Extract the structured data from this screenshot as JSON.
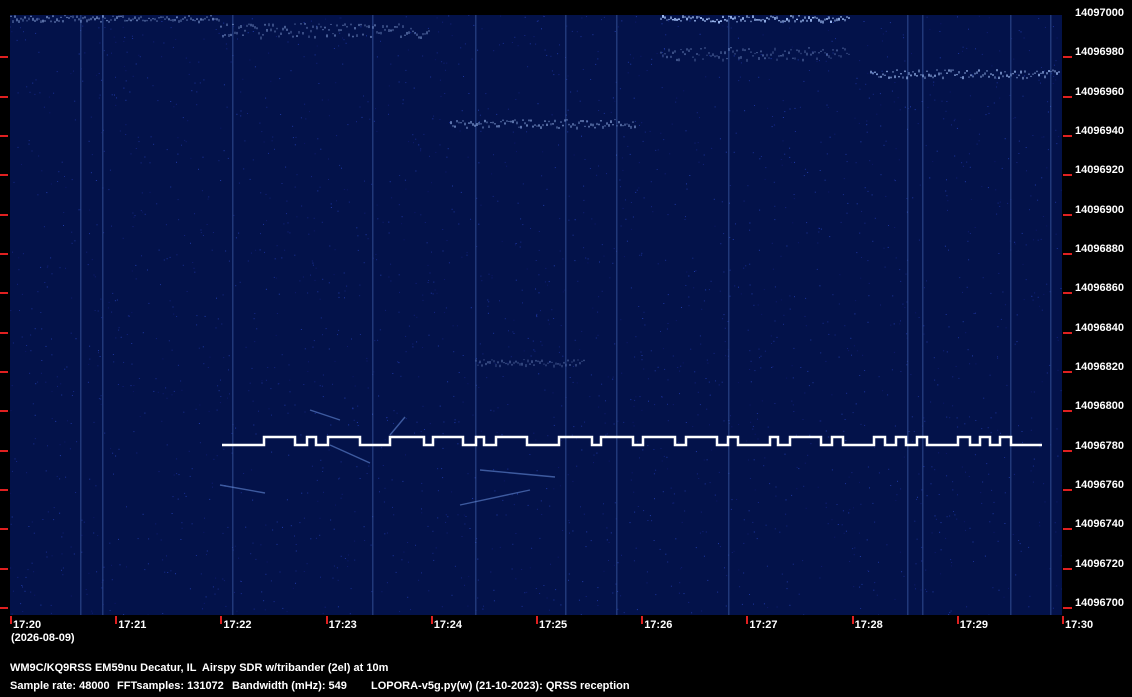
{
  "colors": {
    "background": "#03124a",
    "trace": "#ffffff",
    "tick": "#e02020",
    "text": "#ffffff"
  },
  "frequency_axis": {
    "labels": [
      "14097000",
      "14096980",
      "14096960",
      "14096940",
      "14096920",
      "14096900",
      "14096880",
      "14096860",
      "14096840",
      "14096820",
      "14096800",
      "14096780",
      "14096760",
      "14096740",
      "14096720",
      "14096700"
    ]
  },
  "time_axis": {
    "labels": [
      "17:20",
      "17:21",
      "17:22",
      "17:23",
      "17:24",
      "17:25",
      "17:26",
      "17:27",
      "17:28",
      "17:29",
      "17:30"
    ],
    "date": "(2026-08-09)"
  },
  "footer": {
    "station": "WM9C/KQ9RSS EM59nu Decatur, IL  Airspy SDR w/tribander (2el) at 10m",
    "sample_rate": "Sample rate: 48000",
    "fft_samples": "FFTsamples: 131072",
    "bandwidth": "Bandwidth (mHz): 549",
    "software": "LOPORA-v5g.py(w) (21-10-2023): QRSS reception"
  }
}
